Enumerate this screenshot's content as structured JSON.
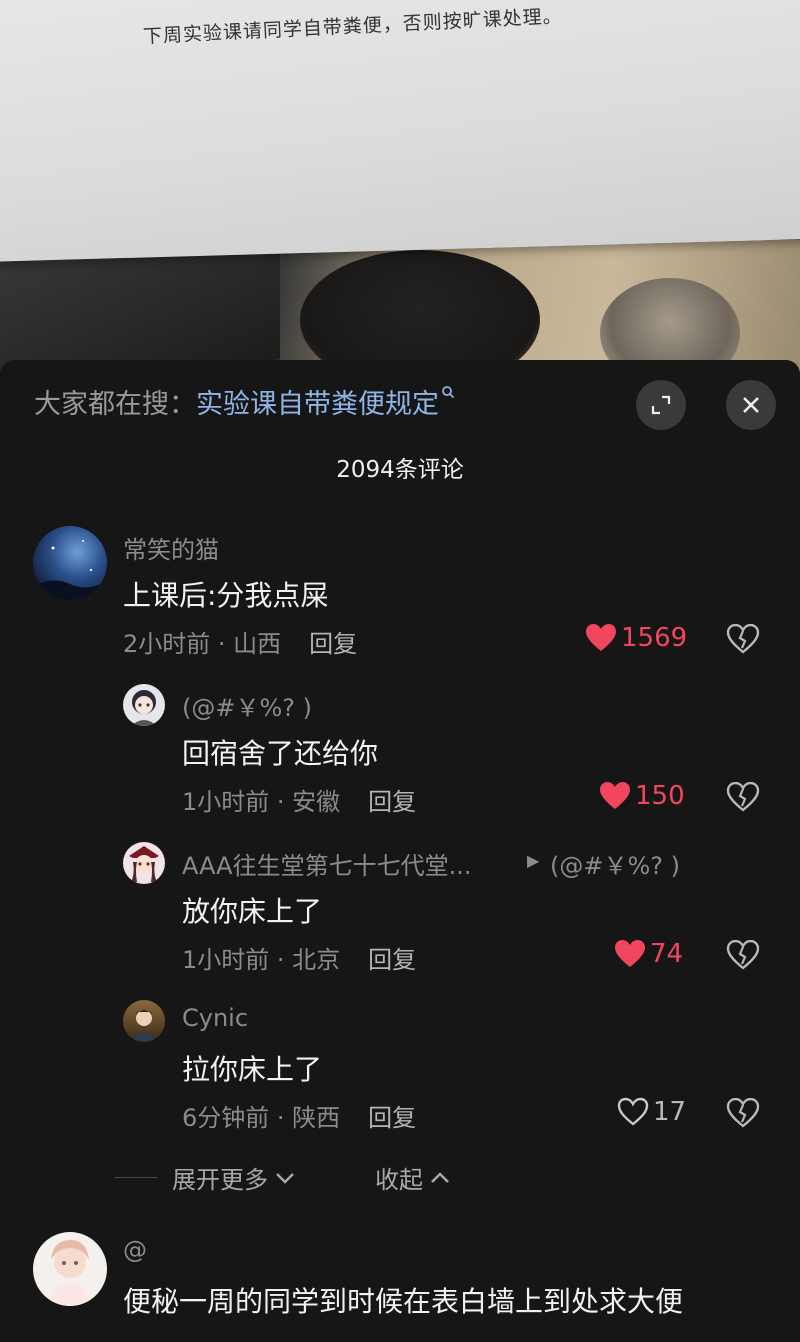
{
  "photo": {
    "paper_text": "下周实验课请同学自带粪便，否则按旷课处理。"
  },
  "search": {
    "prefix": "大家都在搜：",
    "term": "实验课自带粪便规定"
  },
  "comment_count": "2094条评论",
  "comments": [
    {
      "user": "常笑的猫",
      "text": "上课后:分我点屎",
      "time": "2小时前",
      "location": "山西",
      "reply_label": "回复",
      "likes": "1569",
      "liked": true,
      "replies": [
        {
          "user": "(@#￥%? )",
          "text": "回宿舍了还给你",
          "time": "1小时前",
          "location": "安徽",
          "reply_label": "回复",
          "likes": "150",
          "liked": true
        },
        {
          "user": "AAA往生堂第七十七代堂...",
          "reply_to": "(@#￥%? )",
          "text": "放你床上了",
          "time": "1小时前",
          "location": "北京",
          "reply_label": "回复",
          "likes": "74",
          "liked": true
        },
        {
          "user": "Cynic",
          "text": "拉你床上了",
          "time": "6分钟前",
          "location": "陕西",
          "reply_label": "回复",
          "likes": "17",
          "liked": false
        }
      ]
    },
    {
      "user": "@",
      "text": "便秘一周的同学到时候在表白墙上到处求大便"
    }
  ],
  "thread_controls": {
    "expand_more": "展开更多",
    "collapse": "收起"
  },
  "colors": {
    "like_active": "#f2465e",
    "search_term": "#8fb4e6",
    "background": "#161616"
  }
}
